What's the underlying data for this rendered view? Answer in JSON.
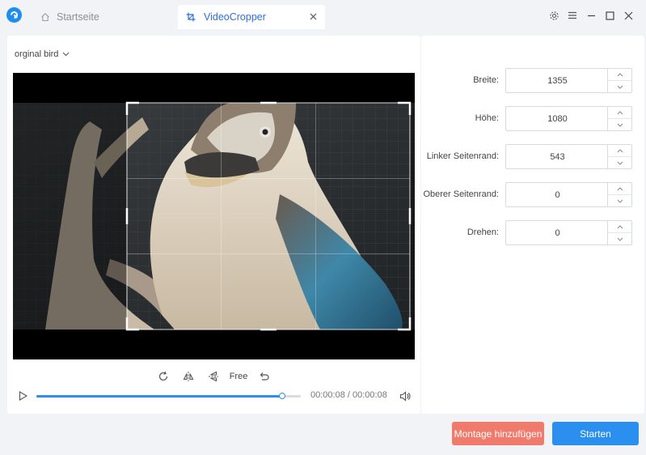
{
  "tabs": {
    "home": {
      "label": "Startseite",
      "icon": "home-icon"
    },
    "active": {
      "label": "VideoCropper",
      "icon": "crop-icon"
    }
  },
  "window_controls": [
    "gear-icon",
    "menu-icon",
    "minimize-icon",
    "maximize-icon",
    "close-icon"
  ],
  "source": {
    "selected": "orginal bird"
  },
  "toolbar": {
    "aspect_label": "Free"
  },
  "playback": {
    "timecode": "00:00:08 / 00:00:08",
    "progress": 0.93
  },
  "fields": [
    {
      "label": "Breite:",
      "value": "1355"
    },
    {
      "label": "Höhe:",
      "value": "1080"
    },
    {
      "label": "Linker Seitenrand:",
      "value": "543"
    },
    {
      "label": "Oberer Seitenrand:",
      "value": "0"
    },
    {
      "label": "Drehen:",
      "value": "0"
    }
  ],
  "buttons": {
    "montage": "Montage hinzufügen",
    "start": "Starten"
  },
  "colors": {
    "accent": "#2b8ff0",
    "montage": "#f07a6c",
    "active_tab_text": "#2f6fd8"
  }
}
